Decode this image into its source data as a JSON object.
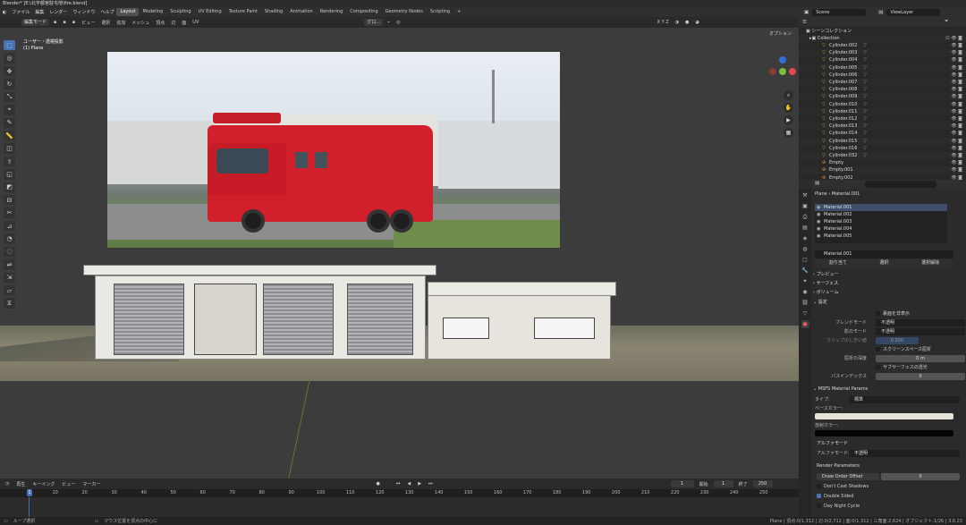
{
  "titlebar": {
    "title": "Blender* [E:\\北宇都宮駐屯地\\fire.blend]"
  },
  "menu": [
    "ファイル",
    "編集",
    "レンダー",
    "ウィンドウ",
    "ヘルプ"
  ],
  "workspaces": [
    "Layout",
    "Modeling",
    "Sculpting",
    "UV Editing",
    "Texture Paint",
    "Shading",
    "Animation",
    "Rendering",
    "Compositing",
    "Geometry Nodes",
    "Scripting"
  ],
  "scene": {
    "name": "Scene",
    "view_layer": "ViewLayer"
  },
  "viewport": {
    "mode": "編集モード",
    "menus": [
      "ビュー",
      "選択",
      "追加",
      "メッシュ",
      "頂点",
      "辺",
      "面",
      "UV"
    ],
    "transform": "グロ...",
    "options": "オプション",
    "axes": "X Y Z",
    "info_line1": "ユーザー・透視投影",
    "info_line2": "(1) Plane"
  },
  "toolbar_icons": [
    "select-icon",
    "cursor-icon",
    "move-icon",
    "rotate-icon",
    "scale-icon",
    "transform-icon",
    "annotate-icon",
    "measure-icon",
    "add-cube-icon",
    "extrude-icon",
    "inset-icon",
    "bevel-icon",
    "loopcut-icon",
    "knife-icon",
    "polybuild-icon",
    "spin-icon",
    "smooth-icon",
    "edge-slide-icon",
    "shrink-icon",
    "shear-icon",
    "rip-icon"
  ],
  "outliner": {
    "root": "シーンコレクション",
    "collection": "Collection",
    "items": [
      "Cylinder.002",
      "Cylinder.003",
      "Cylinder.004",
      "Cylinder.005",
      "Cylinder.006",
      "Cylinder.007",
      "Cylinder.008",
      "Cylinder.009",
      "Cylinder.010",
      "Cylinder.011",
      "Cylinder.012",
      "Cylinder.013",
      "Cylinder.014",
      "Cylinder.015",
      "Cylinder.016",
      "Cylinder.032",
      "Empty",
      "Empty.001",
      "Empty.002"
    ]
  },
  "properties": {
    "breadcrumb_obj": "Plane",
    "breadcrumb_mat": "Material.001",
    "materials": [
      "Material.001",
      "Material.002",
      "Material.003",
      "Material.004",
      "Material.005"
    ],
    "active_material": "Material.001",
    "mat_buttons": [
      "割り当て",
      "選択",
      "選択解除"
    ],
    "sections": [
      "プレビュー",
      "サーフェス",
      "ボリューム",
      "設定"
    ],
    "backface": "裏面を非表示",
    "blend_mode_label": "ブレンドモード",
    "blend_mode": "不透明",
    "shadow_mode_label": "影のモード",
    "shadow_mode": "不透明",
    "clip_label": "クリップのしきい値",
    "clip_value": "0.500",
    "screen_refraction": "スクリーンスペース屈折",
    "refraction_depth_label": "屈折の深度",
    "refraction_depth": "0 m",
    "subsurface": "サブサーフェスの透光",
    "pass_index_label": "パスインデックス",
    "pass_index": "0",
    "msfs_title": "MSFS Material Params",
    "type_label": "タイプ:",
    "type_value": "標準",
    "base_color_label": "ベースカラー:",
    "emissive_label": "放射カラー:",
    "alpha_mode_section": "アルファモード",
    "alpha_mode_label": "アルファモード:",
    "alpha_mode": "不透明",
    "render_params": "Render Parameters",
    "draw_order": "Draw Order Offset",
    "draw_order_value": "0",
    "dont_cast_shadows": "Don't Cast Shadows",
    "double_sided": "Double Sided",
    "day_night": "Day Night Cycle"
  },
  "timeline": {
    "menus": [
      "再生",
      "キーイング",
      "ビュー",
      "マーカー"
    ],
    "current_frame": "1",
    "start_label": "開始",
    "start": "1",
    "end_label": "終了",
    "end": "250",
    "ticks": [
      "1",
      "10",
      "20",
      "30",
      "40",
      "50",
      "60",
      "70",
      "80",
      "90",
      "100",
      "110",
      "120",
      "130",
      "140",
      "150",
      "160",
      "170",
      "180",
      "190",
      "200",
      "210",
      "220",
      "230",
      "240",
      "250"
    ]
  },
  "status": {
    "left1": "ループ選択",
    "left2": "マウス位置を頂点の中心に",
    "right": "Plane | 頂点:0/1,312 | 辺:0/2,712 | 面:0/1,312 | 三角面:2,624 | オブジェクト:1/26 | 3.6.23"
  },
  "colors": {
    "accent": "#4772b3",
    "truck": "#d11f2b",
    "object_icon": "#e99a3b"
  }
}
